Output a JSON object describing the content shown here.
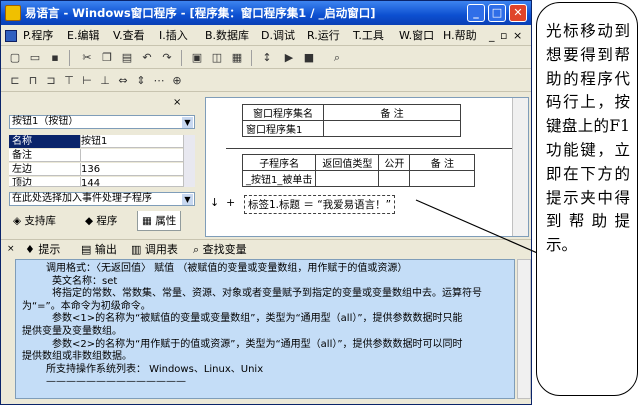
{
  "window": {
    "title": "易语言 - Windows窗口程序 - [程序集：窗口程序集1 / _启动窗口]",
    "min": "_",
    "max": "□",
    "close": "✕"
  },
  "menu": {
    "items": [
      "P.程序",
      "E.编辑",
      "V.查看",
      "I.插入",
      "B.数据库",
      "D.调试",
      "R.运行",
      "T.工具",
      "W.窗口",
      "H.帮助"
    ],
    "doc_controls": "_ ▫ ×"
  },
  "left_panel": {
    "close": "× ",
    "component_select": "按钮1（按钮）",
    "props": [
      {
        "name": "名称",
        "value": "按钮1"
      },
      {
        "name": "备注",
        "value": ""
      },
      {
        "name": "左边",
        "value": "136"
      },
      {
        "name": "顶边",
        "value": "144"
      }
    ],
    "event_select": "在此处选择加入事件处理子程序",
    "tabs": [
      "支持库",
      "程序",
      "属性"
    ]
  },
  "code": {
    "assembly_header": [
      "窗口程序集名",
      "备 注"
    ],
    "assembly_row": [
      "窗口程序集1",
      ""
    ],
    "sub_header": [
      "子程序名",
      "返回值类型",
      "公开",
      "备 注"
    ],
    "sub_row": [
      "_按钮1_被单击",
      "",
      "",
      ""
    ],
    "line": "标签1.标题 ＝ “我爱易语言！”",
    "line_marker": "+",
    "arrow": "↓"
  },
  "bottom_tabs": [
    "提示",
    "输出",
    "调用表",
    "查找变量"
  ],
  "help_text": [
    "调用格式：〈无返回值〉 赋值 （被赋值的变量或变量数组，用作赋于的值或资源）",
    "英文名称：set",
    "将指定的常数、常数集、常量、资源、对象或者变量赋予到指定的变量或变量数组中去。运算符号",
    "为“=”。本命令为初级命令。",
    "参数<1>的名称为“被赋值的变量或变量数组”，类型为“通用型（all）”，提供参数数据时只能",
    "提供变量及变量数组。",
    "参数<2>的名称为“用作赋于的值或资源”，类型为“通用型（all）”，提供参数数据时可以同时",
    "提供数组或非数组数据。",
    "",
    "所支持操作系统列表： Windows、Linux、Unix",
    "",
    "——————————————"
  ],
  "callout": {
    "text": "光标移动到想要得到帮助的程序代码行上，按键盘上的F1功能键，立即在下方的提示夹中得到帮助提示。"
  },
  "colors": {
    "title_blue": "#0c4fd0",
    "help_bg": "#c4ddf7",
    "window_bg": "#ece9d8"
  }
}
